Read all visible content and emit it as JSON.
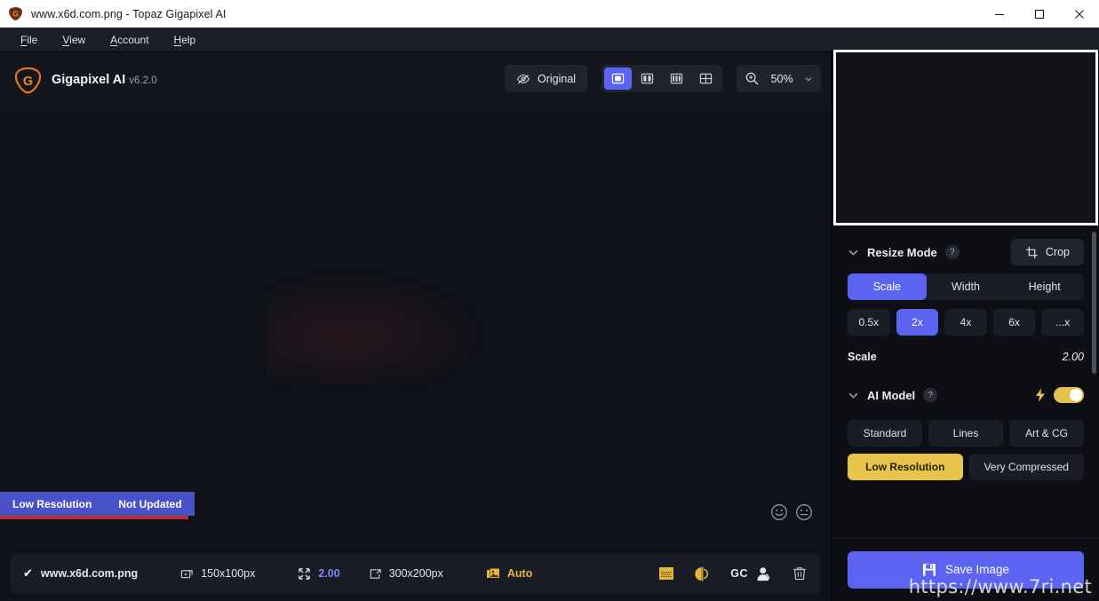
{
  "window": {
    "title": "www.x6d.com.png - Topaz Gigapixel AI",
    "minimize_label": "–",
    "maximize_label": "□",
    "close_label": "✕"
  },
  "menubar": {
    "items": [
      {
        "label": "File",
        "accel": "F",
        "rest": "ile"
      },
      {
        "label": "View",
        "accel": "V",
        "rest": "iew"
      },
      {
        "label": "Account",
        "accel": "A",
        "rest": "ccount"
      },
      {
        "label": "Help",
        "accel": "H",
        "rest": "elp"
      }
    ]
  },
  "header": {
    "brand_name": "Gigapixel AI",
    "brand_version": "v6.2.0",
    "original_label": "Original",
    "view_modes": [
      {
        "name": "single-view",
        "active": true
      },
      {
        "name": "split-two-view",
        "active": false
      },
      {
        "name": "split-three-view",
        "active": false
      },
      {
        "name": "grid-view",
        "active": false
      }
    ],
    "zoom_value": "50%",
    "zoom_chevron": "⌄"
  },
  "canvas": {
    "badge_low_resolution": "Low Resolution",
    "badge_not_updated": "Not Updated",
    "feedback_positive": "☺",
    "feedback_neutral": "☹"
  },
  "filmstrip": {
    "checked": "✔",
    "filename": "www.x6d.com.png",
    "input_size": "150x100px",
    "scale": "2.00",
    "output_size": "300x200px",
    "mode": "Auto",
    "gc_label": "GC"
  },
  "panel": {
    "resize": {
      "title": "Resize Mode",
      "help": "?",
      "chevron": "⌄",
      "crop_label": "Crop",
      "tabs": [
        {
          "label": "Scale",
          "active": true
        },
        {
          "label": "Width",
          "active": false
        },
        {
          "label": "Height",
          "active": false
        }
      ],
      "chips": [
        {
          "label": "0.5x",
          "active": false
        },
        {
          "label": "2x",
          "active": true
        },
        {
          "label": "4x",
          "active": false
        },
        {
          "label": "6x",
          "active": false
        },
        {
          "label": "...x",
          "active": false
        }
      ],
      "scale_key": "Scale",
      "scale_value": "2.00"
    },
    "ai_model": {
      "title": "AI Model",
      "help": "?",
      "chevron": "⌄",
      "toggle_on": true,
      "models_row1": [
        {
          "label": "Standard",
          "active": false
        },
        {
          "label": "Lines",
          "active": false
        },
        {
          "label": "Art & CG",
          "active": false
        }
      ],
      "models_row2": [
        {
          "label": "Low Resolution",
          "active": true
        },
        {
          "label": "Very Compressed",
          "active": false
        }
      ]
    },
    "save_label": "Save Image"
  },
  "watermark": "https://www.7ri.net",
  "colors": {
    "accent_blue": "#5b63f0",
    "accent_gold": "#e9c44c",
    "badge_blue": "#4a52c8",
    "badge_red": "#bf2b33",
    "panel_bg": "#0d0f14"
  }
}
